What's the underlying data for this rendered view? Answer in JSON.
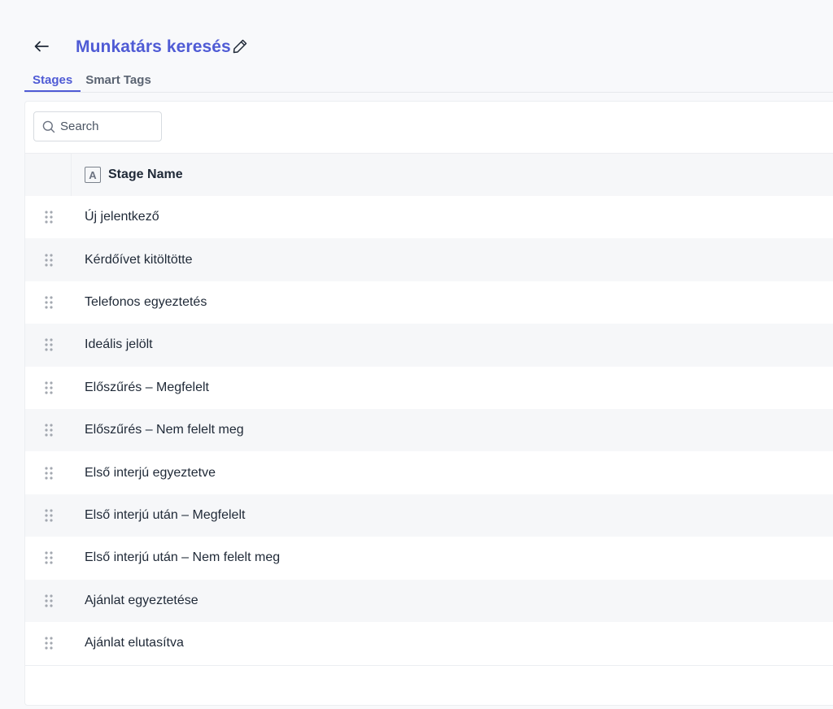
{
  "header": {
    "title": "Munkatárs keresés",
    "back_icon": "arrow-left-icon",
    "edit_icon": "pencil-icon",
    "accent_color": "#4f5bd5"
  },
  "tabs": [
    {
      "label": "Stages",
      "active": true
    },
    {
      "label": "Smart Tags",
      "active": false
    }
  ],
  "search": {
    "placeholder": "Search",
    "value": ""
  },
  "table": {
    "column_header": "Stage Name",
    "column_type_icon": "A",
    "rows": [
      "Új jelentkező",
      "Kérdőívet kitöltötte",
      "Telefonos egyeztetés",
      "Ideális jelölt",
      "Előszűrés – Megfelelt",
      "Előszűrés – Nem felelt meg",
      "Első interjú egyeztetve",
      "Első interjú után – Megfelelt",
      "Első interjú után – Nem felelt meg",
      "Ajánlat egyeztetése",
      "Ajánlat elutasítva"
    ]
  }
}
